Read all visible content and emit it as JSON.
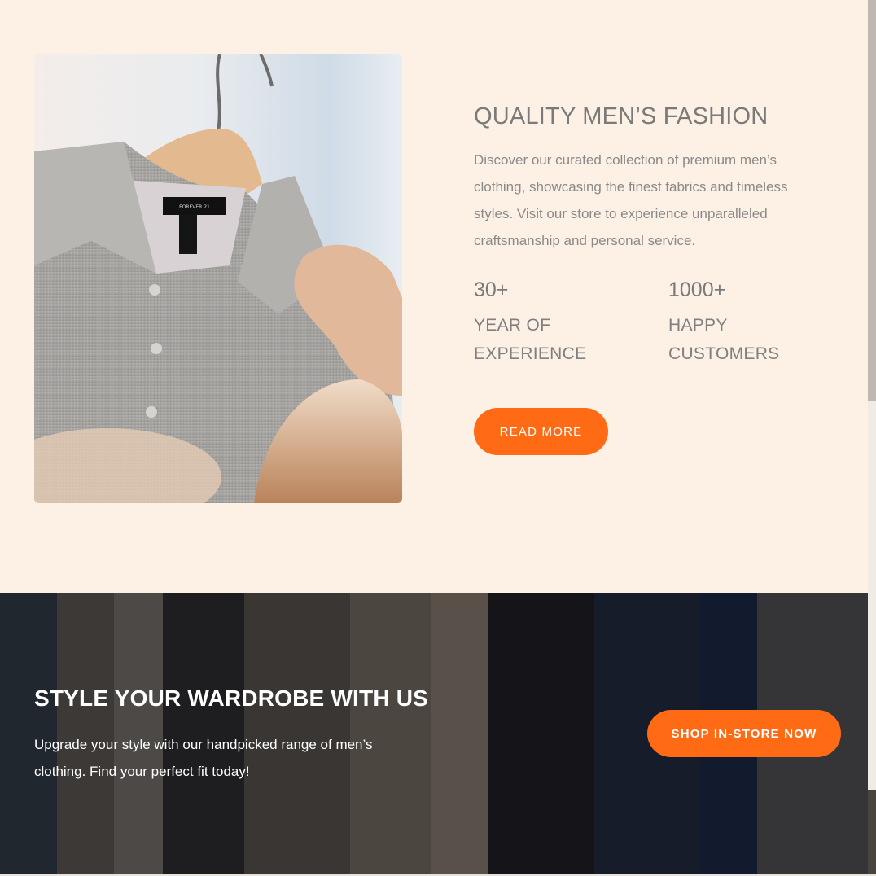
{
  "about": {
    "title": "QUALITY MEN’S FASHION",
    "description": "Discover our curated collection of premium men’s clothing, showcasing the finest fabrics and timeless styles. Visit our store to experience unparalleled craftsmanship and personal service.",
    "stats": [
      {
        "number": "30+",
        "label_line1": "YEAR OF",
        "label_line2": "EXPERIENCE"
      },
      {
        "number": "1000+",
        "label_line1": "HAPPY",
        "label_line2": "CUSTOMERS"
      }
    ],
    "button_label": "READ MORE",
    "tag_text": "FOREVER 21"
  },
  "cta": {
    "title": "STYLE YOUR WARDROBE WITH US",
    "description": "Upgrade your style with our handpicked range of men’s clothing. Find your perfect fit today!",
    "button_label": "SHOP IN-STORE NOW"
  },
  "colors": {
    "background": "#fdf0e4",
    "accent": "#ff6a14",
    "heading": "#7a7a7a",
    "body_text": "#8a8a8a"
  }
}
